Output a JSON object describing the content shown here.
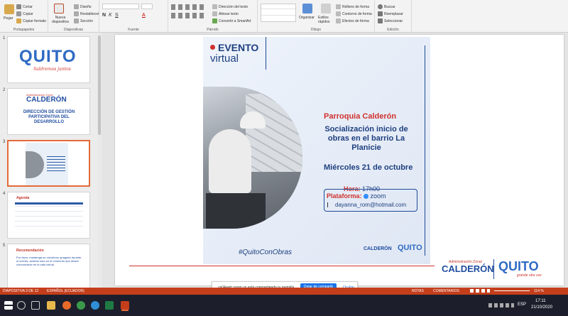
{
  "ribbon": {
    "clipboard": {
      "paste": "Pegar",
      "cut": "Cortar",
      "copy": "Copiar",
      "format": "Copiar formato",
      "label": "Portapapeles"
    },
    "slides": {
      "new": "Nueva diapositiva",
      "layout": "Diseño",
      "reset": "Restablecer",
      "section": "Sección",
      "label": "Diapositivas"
    },
    "font": {
      "label": "Fuente"
    },
    "paragraph": {
      "text_dir": "Dirección del texto",
      "align": "Alinear texto",
      "smartart": "Convertir a SmartArt",
      "label": "Párrafo"
    },
    "drawing": {
      "arrange": "Organizar",
      "styles": "Estilos rápidos",
      "fill": "Relleno de forma",
      "outline": "Contorno de forma",
      "effects": "Efectos de forma",
      "label": "Dibujo"
    },
    "editing": {
      "find": "Buscar",
      "replace": "Reemplazar",
      "select": "Seleccionar",
      "label": "Edición"
    }
  },
  "thumbnails": [
    {
      "num": "1",
      "logo": "QUITO",
      "tagline": "Saldremos juntos"
    },
    {
      "num": "2",
      "header": "Administración Zonal",
      "zone": "CALDERÓN",
      "title": "DIRECCIÓN DE GESTIÓN PARTICIPATIVA DEL DESARROLLO"
    },
    {
      "num": "3"
    },
    {
      "num": "4",
      "title": "Agenda"
    },
    {
      "num": "5",
      "title": "Recomendación",
      "body": "Por favor, mantenga su micrófono apagado durante el evento; activelo solo en el momento que desee comunicarse en la sala virtual."
    }
  ],
  "poster": {
    "evento": "EVENTO",
    "virtual": "virtual",
    "parish": "Parroquia Calderón",
    "headline": "Socialización inicio de obras en el barrio La Planicie",
    "date": "Miércoles 21 de octubre",
    "hora_label": "Hora:",
    "hora": "17h00",
    "plataforma_label": "Plataforma:",
    "platform": "zoom",
    "email": "dayanna_rom@hotmail.com",
    "hashtag": "#QuitoConObras",
    "zone_small": "CALDERÓN",
    "quito_small": "QUITO"
  },
  "footer": {
    "admin": "Administración Zonal",
    "zone": "CALDERÓN",
    "quito": "QUITO",
    "tagline": "grande otra vez"
  },
  "share_bar": {
    "text": "us04web.zoom.us está compartiendo tu pantalla.",
    "stop": "Dejar de compartir",
    "hide": "Ocultar"
  },
  "status": {
    "slide": "DIAPOSITIVA 3 DE 12",
    "lang": "ESPAÑOL (ECUADOR)",
    "notes": "NOTAS",
    "comments": "COMENTARIOS",
    "zoom": "114 %"
  },
  "taskbar": {
    "lang": "ESP",
    "time": "17:11",
    "date": "21/10/2020"
  }
}
